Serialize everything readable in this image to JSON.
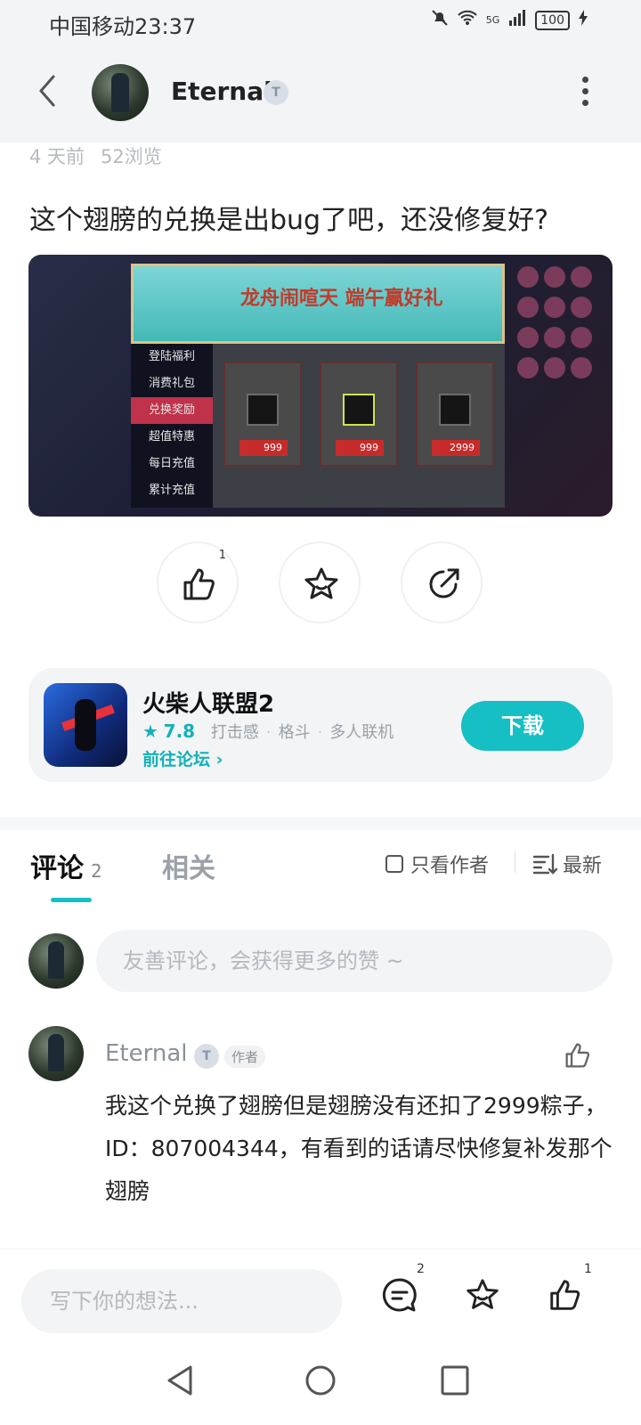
{
  "status_bar": {
    "carrier_time": "中国移动23:37",
    "network": "5G",
    "battery": "100"
  },
  "header": {
    "author_name": "Eternal",
    "badge": "T"
  },
  "post": {
    "age": "4 天前",
    "views": "52浏览",
    "title": "这个翅膀的兑换是出bug了吧，还没修复好?",
    "image": {
      "banner_text": "龙舟闹喧天 端午赢好礼",
      "menu_items": [
        "登陆福利",
        "消费礼包",
        "兑换奖励",
        "超值特惠",
        "每日充值",
        "累计充值"
      ],
      "active_menu_index": 2,
      "card_prices": [
        "999",
        "999",
        "2999"
      ]
    },
    "like_count": "1"
  },
  "game_card": {
    "name": "火柴人联盟2",
    "rating": "7.8",
    "tags": [
      "打击感",
      "格斗",
      "多人联机"
    ],
    "forum_link": "前往论坛",
    "download_label": "下载"
  },
  "comments": {
    "tab_label": "评论",
    "count": "2",
    "related_label": "相关",
    "only_author_label": "只看作者",
    "sort_label": "最新",
    "input_placeholder": "友善评论，会获得更多的赞 ~",
    "items": [
      {
        "name": "Eternal",
        "badge": "T",
        "tag": "作者",
        "text": "我这个兑换了翅膀但是翅膀没有还扣了2999粽子，ID：807004344，有看到的话请尽快修复补发那个翅膀"
      }
    ]
  },
  "bottom_bar": {
    "placeholder": "写下你的想法...",
    "comment_count": "2",
    "like_count": "1"
  }
}
